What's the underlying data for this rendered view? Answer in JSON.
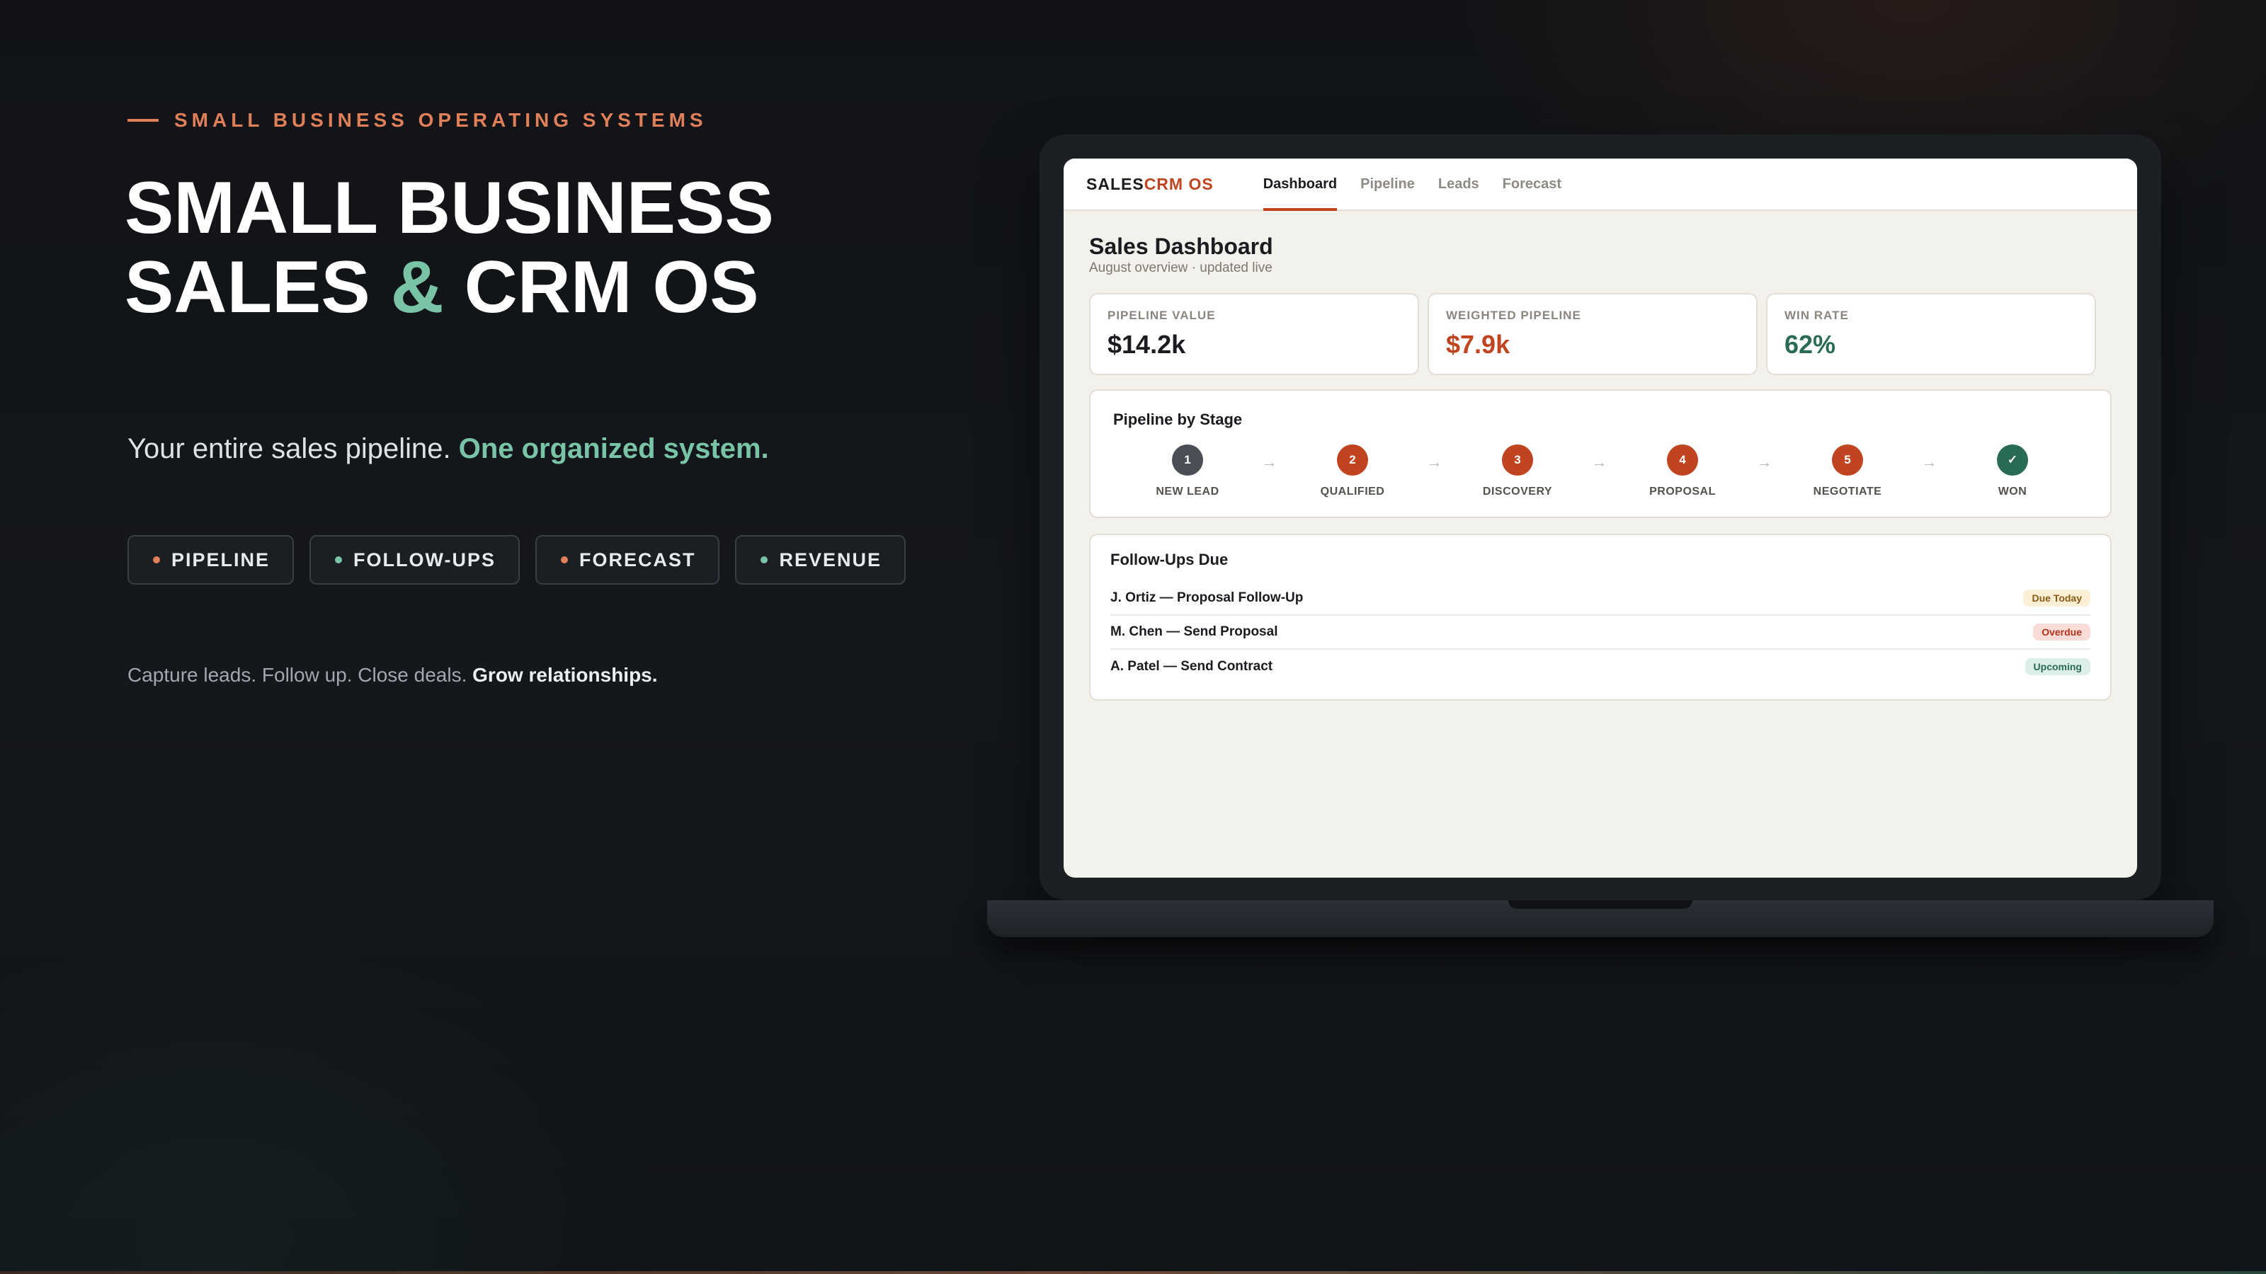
{
  "hero": {
    "eyebrow": "SMALL BUSINESS OPERATING SYSTEMS",
    "title_line1": "SMALL BUSINESS",
    "title_line2_a": "SALES ",
    "title_line2_amp": "&",
    "title_line2_b": " CRM OS",
    "tagline_plain": "Your entire sales pipeline. ",
    "tagline_accent": "One organized system.",
    "chips": [
      {
        "label": "PIPELINE",
        "dot_color": "#e0805a"
      },
      {
        "label": "FOLLOW-UPS",
        "dot_color": "#79c4a6"
      },
      {
        "label": "FORECAST",
        "dot_color": "#e0805a"
      },
      {
        "label": "REVENUE",
        "dot_color": "#79c4a6"
      }
    ],
    "closing_plain": "Capture leads. Follow up. Close deals. ",
    "closing_strong": "Grow relationships."
  },
  "app": {
    "brand_a": "SALES",
    "brand_b": "CRM OS",
    "tabs": [
      {
        "label": "Dashboard",
        "active": true
      },
      {
        "label": "Pipeline",
        "active": false
      },
      {
        "label": "Leads",
        "active": false
      },
      {
        "label": "Forecast",
        "active": false
      }
    ],
    "page_title": "Sales Dashboard",
    "page_subtitle": "August overview · updated live",
    "kpis": [
      {
        "label": "PIPELINE VALUE",
        "value": "$14.2k",
        "color": "#1a1c1f"
      },
      {
        "label": "WEIGHTED PIPELINE",
        "value": "$7.9k",
        "color": "#c0441f"
      },
      {
        "label": "WIN RATE",
        "value": "62%",
        "color": "#2a6b55"
      }
    ],
    "stages_title": "Pipeline by Stage",
    "stages": [
      {
        "step": "1",
        "name": "NEW LEAD",
        "color": "#4a4e55"
      },
      {
        "step": "2",
        "name": "QUALIFIED",
        "color": "#c0441f"
      },
      {
        "step": "3",
        "name": "DISCOVERY",
        "color": "#c0441f"
      },
      {
        "step": "4",
        "name": "PROPOSAL",
        "color": "#c0441f"
      },
      {
        "step": "5",
        "name": "NEGOTIATE",
        "color": "#c0441f"
      },
      {
        "step": "✓",
        "name": "WON",
        "color": "#2a6b55"
      }
    ],
    "stage_arrow": "→",
    "followups_title": "Follow-Ups Due",
    "followups": [
      {
        "who": "J. Ortiz — Proposal Follow-Up",
        "status": "Due Today",
        "bg": "#fbefd6",
        "fg": "#8a5a12"
      },
      {
        "who": "M. Chen — Send Proposal",
        "status": "Overdue",
        "bg": "#f9dcd6",
        "fg": "#b3321e"
      },
      {
        "who": "A. Patel — Send Contract",
        "status": "Upcoming",
        "bg": "#dcefe6",
        "fg": "#2a6b55"
      }
    ]
  }
}
